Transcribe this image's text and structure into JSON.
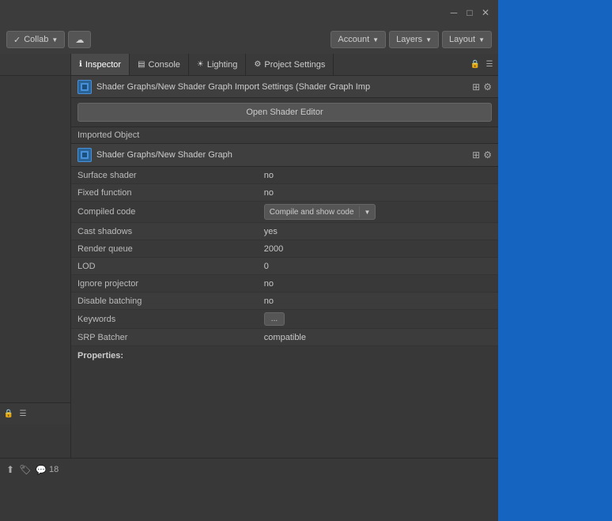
{
  "titlebar": {
    "minimize": "─",
    "maximize": "□",
    "close": "✕"
  },
  "toolbar": {
    "collab_label": "Collab",
    "cloud_label": "☁",
    "account_label": "Account",
    "layers_label": "Layers",
    "layout_label": "Layout"
  },
  "tabs": {
    "inspector_label": "Inspector",
    "console_label": "Console",
    "lighting_label": "Lighting",
    "project_settings_label": "Project Settings"
  },
  "import_header": {
    "title": "Shader Graphs/New Shader Graph Import Settings (Shader Graph Imp",
    "open_btn": "Open Shader Editor"
  },
  "imported_object": {
    "section_label": "Imported Object",
    "name": "Shader Graphs/New Shader Graph"
  },
  "properties": [
    {
      "label": "Surface shader",
      "value": "no",
      "type": "text"
    },
    {
      "label": "Fixed function",
      "value": "no",
      "type": "text"
    },
    {
      "label": "Compiled code",
      "value": "Compile and show code",
      "type": "dropdown"
    },
    {
      "label": "Cast shadows",
      "value": "yes",
      "type": "text"
    },
    {
      "label": "Render queue",
      "value": "2000",
      "type": "text"
    },
    {
      "label": "LOD",
      "value": "0",
      "type": "text"
    },
    {
      "label": "Ignore projector",
      "value": "no",
      "type": "text"
    },
    {
      "label": "Disable batching",
      "value": "no",
      "type": "text"
    },
    {
      "label": "Keywords",
      "value": "...",
      "type": "button"
    },
    {
      "label": "SRP Batcher",
      "value": "compatible",
      "type": "text"
    }
  ],
  "properties_footer": "Properties:",
  "bottom_bar": {
    "icon1": "⬆",
    "icon2": "🏷",
    "icon3": "💬",
    "count": "18"
  },
  "colors": {
    "accent_blue": "#2a6496",
    "right_panel": "#1565c0"
  }
}
